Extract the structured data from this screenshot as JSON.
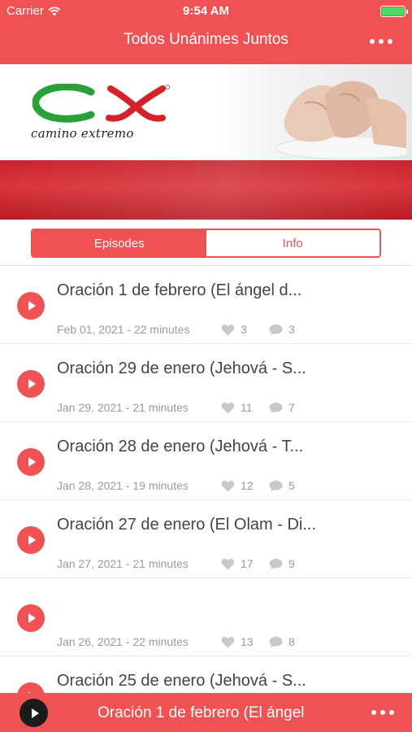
{
  "status_bar": {
    "carrier": "Carrier",
    "time": "9:54 AM"
  },
  "nav": {
    "title": "Todos Unánimes Juntos",
    "menu_icon": "more-dots-icon"
  },
  "banner": {
    "brand_name": "camino extremo",
    "logo_letters": "CX",
    "colors": {
      "green": "#2ba03a",
      "red": "#d4222a"
    }
  },
  "tabs": [
    {
      "label": "Episodes",
      "active": true
    },
    {
      "label": "Info",
      "active": false
    }
  ],
  "episodes": [
    {
      "title": "Oración 1 de febrero (El ángel d...",
      "meta": "Feb 01, 2021 - 22 minutes",
      "likes": "3",
      "comments": "3"
    },
    {
      "title": "Oración 29 de enero (Jehová - S...",
      "meta": "Jan 29, 2021 - 21 minutes",
      "likes": "11",
      "comments": "7"
    },
    {
      "title": "Oración 28 de enero (Jehová - T...",
      "meta": "Jan 28, 2021 - 19 minutes",
      "likes": "12",
      "comments": "5"
    },
    {
      "title": "Oración 27 de enero (El Olam - Di...",
      "meta": "Jan 27, 2021 - 21 minutes",
      "likes": "17",
      "comments": "9"
    },
    {
      "title": "",
      "meta": "Jan 26, 2021 - 22 minutes",
      "likes": "13",
      "comments": "8"
    },
    {
      "title": "Oración 25 de enero (Jehová - S...",
      "meta": "",
      "likes": "",
      "comments": ""
    }
  ],
  "player": {
    "title": "Oración 1 de febrero (El ángel"
  },
  "colors": {
    "accent": "#ee5253",
    "muted_text": "#9b9b9b"
  }
}
